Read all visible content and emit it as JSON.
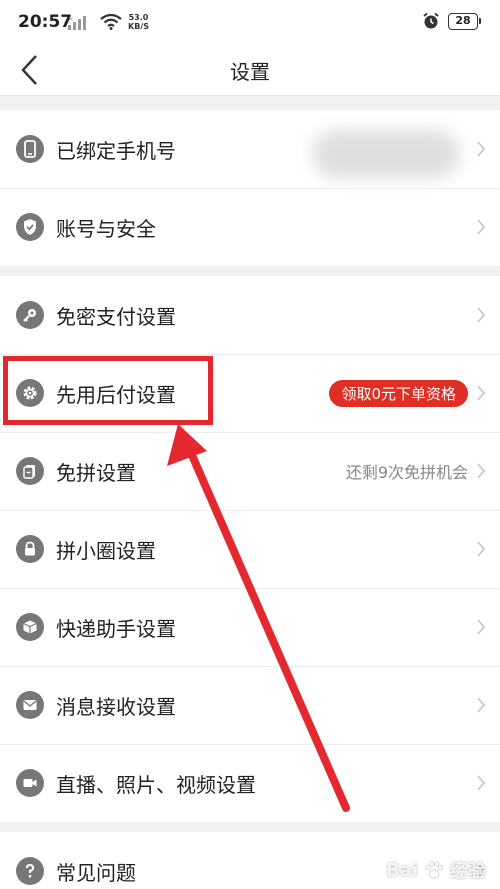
{
  "status_bar": {
    "time": "20:57",
    "net_speed": "53.0",
    "net_unit": "KB/S",
    "battery": "28"
  },
  "nav": {
    "title": "设置"
  },
  "groups": [
    {
      "rows": [
        {
          "label": "已绑定手机号",
          "icon": "phone-icon"
        },
        {
          "label": "账号与安全",
          "icon": "shield-icon"
        }
      ]
    },
    {
      "rows": [
        {
          "label": "免密支付设置",
          "icon": "key-icon"
        },
        {
          "label": "先用后付设置",
          "icon": "gear-icon",
          "badge": "领取0元下单资格"
        },
        {
          "label": "免拼设置",
          "icon": "card-icon",
          "sub": "还剩9次免拼机会"
        },
        {
          "label": "拼小圈设置",
          "icon": "lock-icon"
        },
        {
          "label": "快递助手设置",
          "icon": "package-icon"
        },
        {
          "label": "消息接收设置",
          "icon": "envelope-icon"
        },
        {
          "label": "直播、照片、视频设置",
          "icon": "video-camera-icon"
        }
      ]
    },
    {
      "rows": [
        {
          "label": "常见问题",
          "icon": "question-icon"
        }
      ]
    }
  ],
  "watermark": {
    "left": "Bai",
    "right": "经验"
  },
  "colors": {
    "accent_red": "#e02e24",
    "annotation_red": "#e3282f",
    "icon_gray": "#777777"
  }
}
